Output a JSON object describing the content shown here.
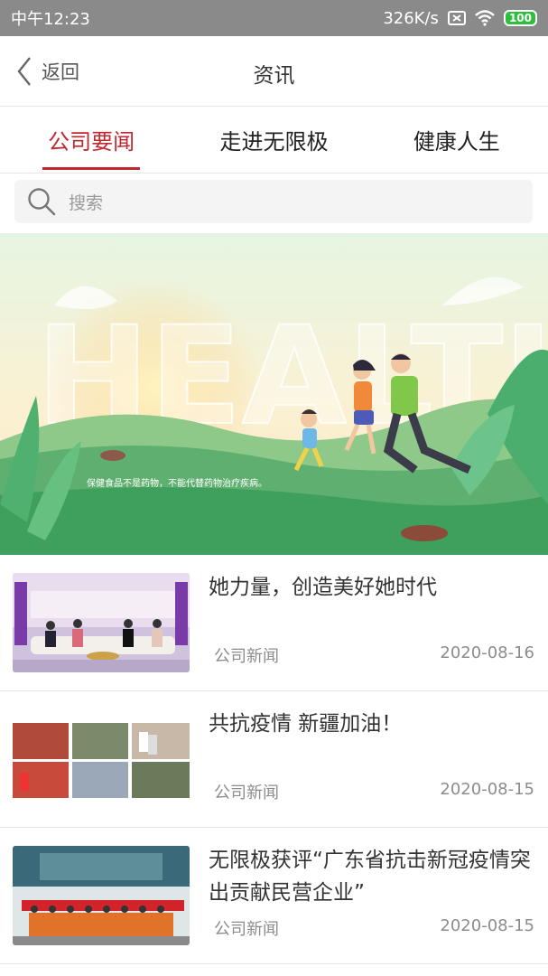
{
  "status_bar": {
    "time": "中午12:23",
    "speed": "326K/s",
    "battery": "100"
  },
  "nav": {
    "back_label": "返回",
    "title": "资讯"
  },
  "tabs": [
    {
      "label": "公司要闻",
      "active": true
    },
    {
      "label": "走进无限极",
      "active": false
    },
    {
      "label": "健康人生",
      "active": false
    }
  ],
  "search": {
    "placeholder": "搜索"
  },
  "banner": {
    "word": "HEALTH",
    "caption": "保健食品不是药物，不能代替药物治疗疾病。"
  },
  "news": [
    {
      "title": "她力量，创造美好她时代",
      "category": "公司新闻",
      "date": "2020-08-16"
    },
    {
      "title": "共抗疫情 新疆加油！",
      "category": "公司新闻",
      "date": "2020-08-15"
    },
    {
      "title": "无限极获评“广东省抗击新冠疫情突出贡献民营企业”",
      "category": "公司新闻",
      "date": "2020-08-15"
    }
  ]
}
